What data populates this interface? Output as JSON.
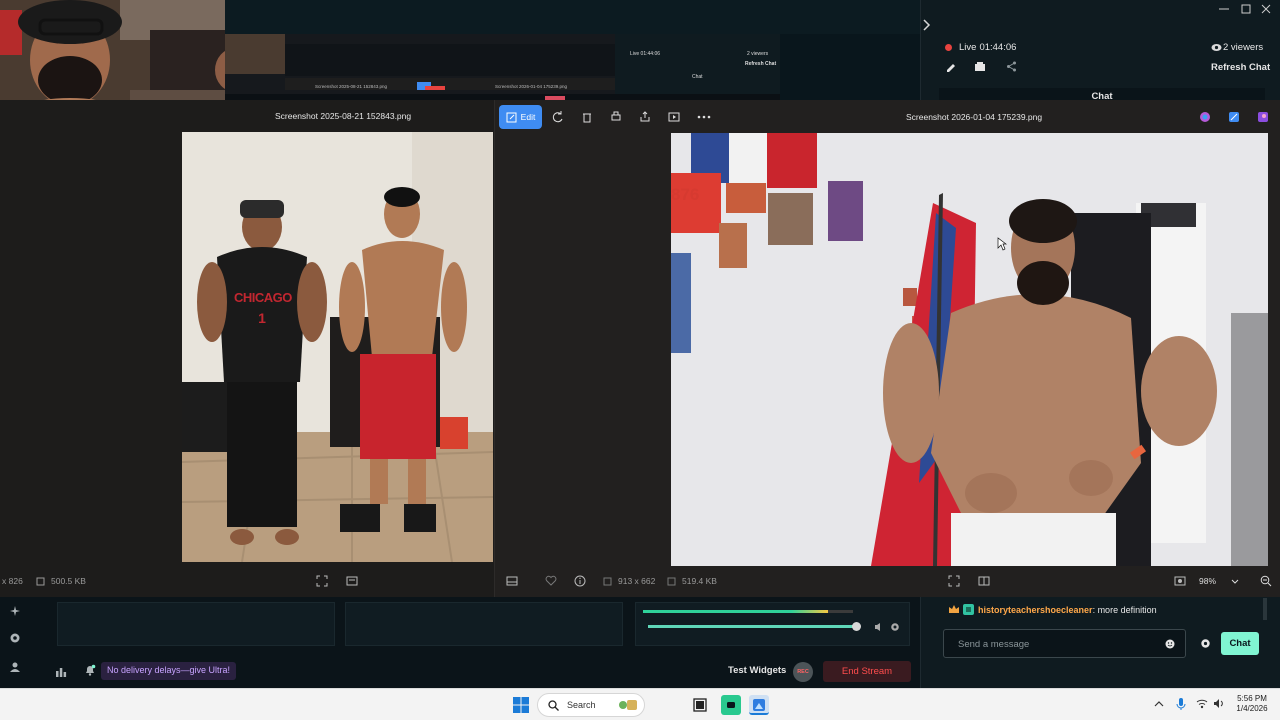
{
  "stream": {
    "live_label": "Live",
    "live_time": "01:44:06",
    "viewers": "2 viewers",
    "refresh_chat": "Refresh Chat",
    "chat_header": "Chat"
  },
  "nested_preview": {
    "title_left": "Screenshot 2025-08-21 152843.png",
    "title_right": "Screenshot 2026-01-04 175239.png",
    "live": "Live 01:44:06",
    "viewers": "2 viewers",
    "refresh": "Refresh Chat",
    "chat": "Chat"
  },
  "viewer_left": {
    "title": "Screenshot 2025-08-21 152843.png",
    "dimensions": "x 826",
    "size": "500.5 KB",
    "photo_text": {
      "shirt": "CHICAGO",
      "number": "1"
    }
  },
  "viewer_right": {
    "title": "Screenshot 2026-01-04 175239.png",
    "edit_label": "Edit",
    "dimensions": "913 x 662",
    "size": "519.4 KB",
    "zoom": "98%",
    "photo_text": {
      "poster": "876"
    }
  },
  "dock": {
    "promo": "No delivery delays—give Ultra!",
    "test_widgets": "Test Widgets",
    "rec_badge": "REC",
    "end_stream": "End Stream"
  },
  "chat": {
    "message": {
      "user": "historyteachershoecleaner",
      "text": ": more definition"
    },
    "input_placeholder": "Send a message",
    "send_label": "Chat"
  },
  "taskbar": {
    "search_placeholder": "Search",
    "time": "5:56 PM",
    "date": "1/4/2026"
  },
  "colors": {
    "accent": "#80f5d2",
    "live_dot": "#e8433f",
    "edit_blue": "#3f8cf2",
    "end_stream": "#ff4d4d",
    "promo": "#c7a3ff",
    "username": "#ffa84a"
  }
}
